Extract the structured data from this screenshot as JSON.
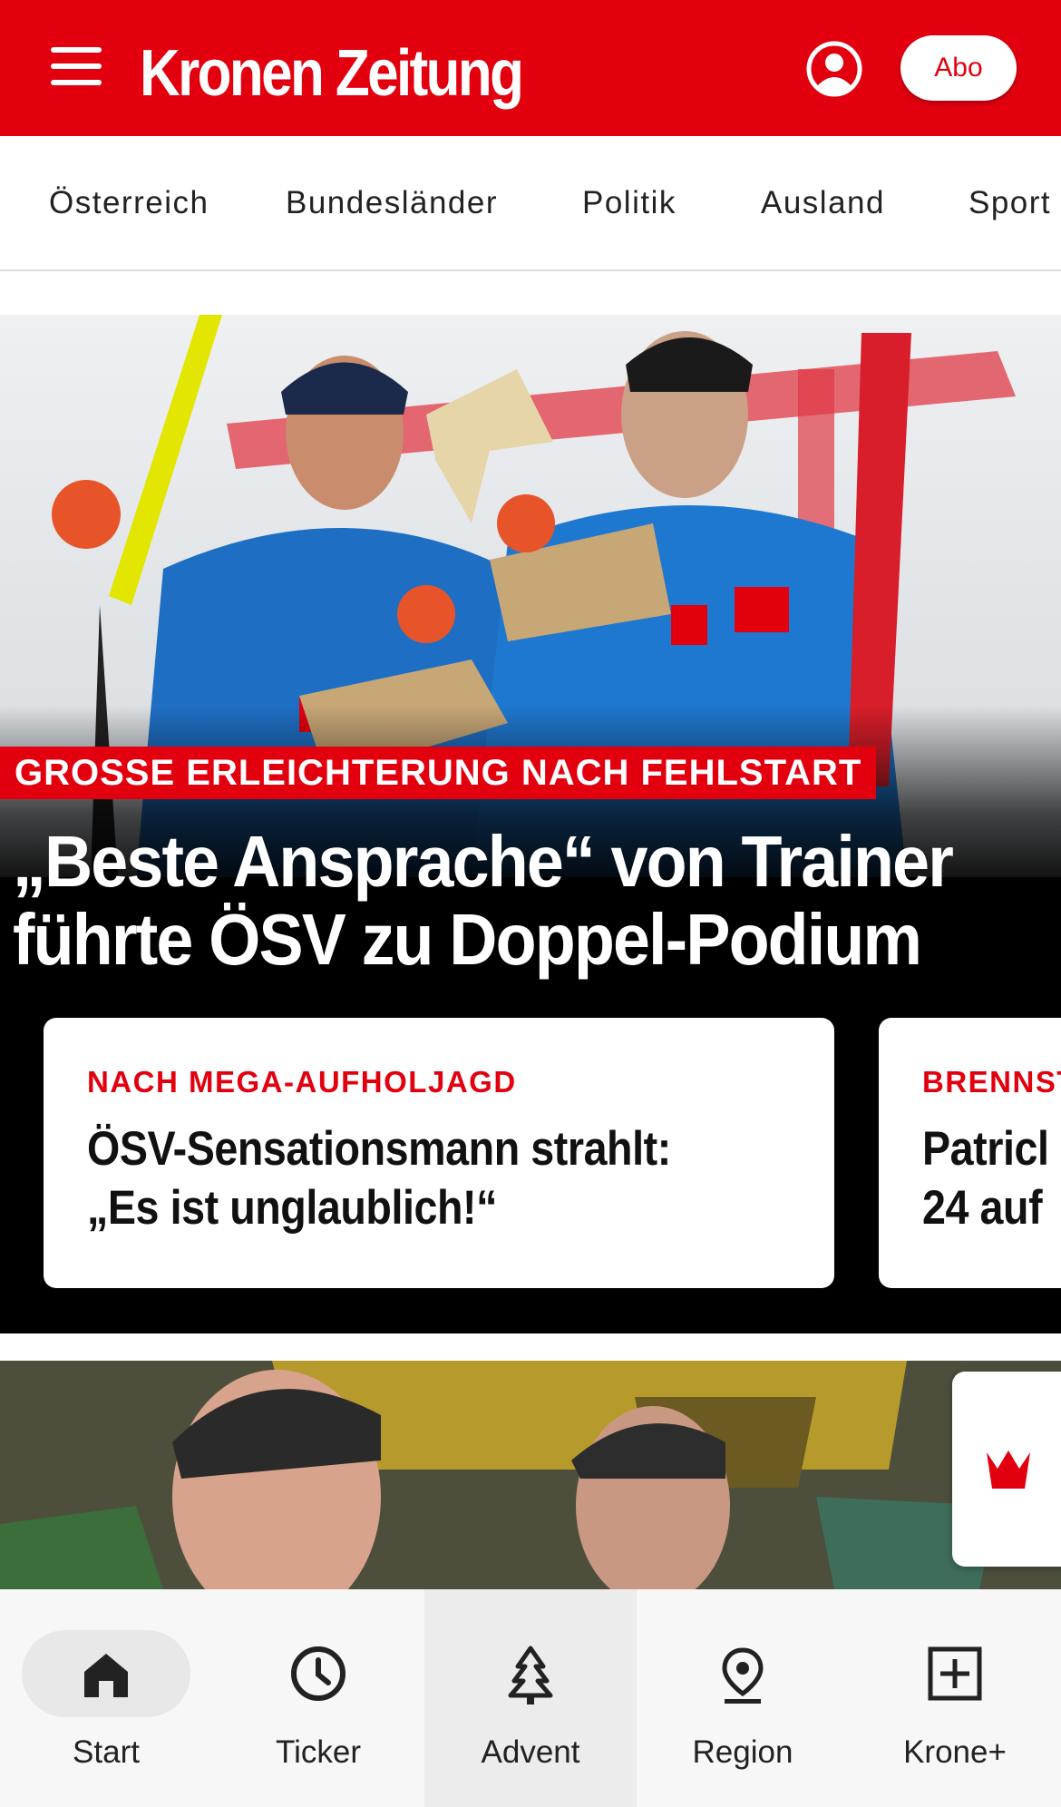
{
  "header": {
    "logo": "Kronen Zeitung",
    "abo_label": "Abo"
  },
  "nav": {
    "items": [
      "Österreich",
      "Bundesländer",
      "Politik",
      "Ausland",
      "Sport"
    ]
  },
  "hero": {
    "kicker": "GROSSE ERLEICHTERUNG NACH FEHLSTART",
    "title": "„Beste Ansprache“ von Trainer führte ÖSV zu Doppel-Podium"
  },
  "cards": [
    {
      "kicker": "NACH MEGA-AUFHOLJAGD",
      "title": "ÖSV-Sensationsmann strahlt:\n„Es ist unglaublich!“"
    },
    {
      "kicker": "BRENNST",
      "title": "Patricl\n24 auf"
    }
  ],
  "bottom_nav": [
    {
      "label": "Start",
      "icon": "home-icon"
    },
    {
      "label": "Ticker",
      "icon": "clock-icon"
    },
    {
      "label": "Advent",
      "icon": "tree-icon"
    },
    {
      "label": "Region",
      "icon": "location-icon"
    },
    {
      "label": "Krone+",
      "icon": "plus-box-icon"
    }
  ],
  "colors": {
    "brand_red": "#e2000f",
    "text_dark": "#222222"
  }
}
